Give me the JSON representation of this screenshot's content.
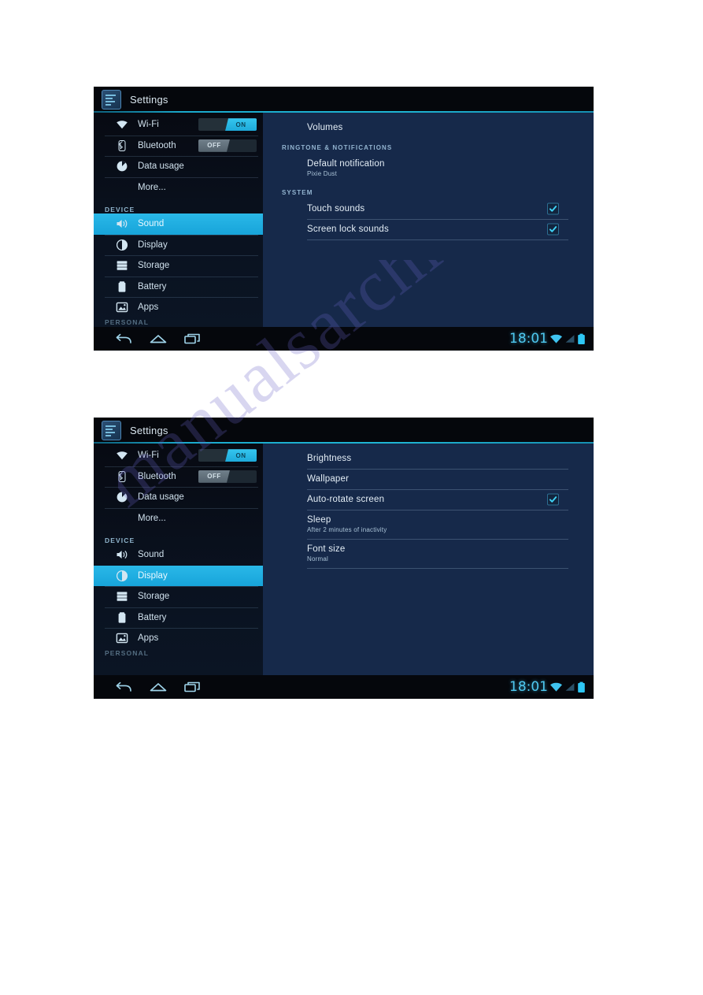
{
  "page": {
    "watermark_text": "manualsarchive.com"
  },
  "screenshots": [
    {
      "id": "sound-settings",
      "action_bar": {
        "icon": "settings-app-icon",
        "title": "Settings"
      },
      "sidebar": {
        "rows": [
          {
            "type": "item",
            "icon": "wifi-icon",
            "label": "Wi-Fi",
            "toggle": "ON",
            "toggle_state": "on",
            "selected": false
          },
          {
            "type": "item",
            "icon": "bluetooth-icon",
            "label": "Bluetooth",
            "toggle": "OFF",
            "toggle_state": "off",
            "selected": false
          },
          {
            "type": "item",
            "icon": "data-usage-icon",
            "label": "Data usage",
            "selected": false
          },
          {
            "type": "item",
            "icon": null,
            "label": "More...",
            "selected": false
          },
          {
            "type": "header",
            "label": "DEVICE"
          },
          {
            "type": "item",
            "icon": "sound-icon",
            "label": "Sound",
            "selected": true
          },
          {
            "type": "item",
            "icon": "display-icon",
            "label": "Display",
            "selected": false
          },
          {
            "type": "item",
            "icon": "storage-icon",
            "label": "Storage",
            "selected": false
          },
          {
            "type": "item",
            "icon": "battery-icon",
            "label": "Battery",
            "selected": false
          },
          {
            "type": "item",
            "icon": "apps-icon",
            "label": "Apps",
            "selected": false
          },
          {
            "type": "header-clipped",
            "label": "PERSONAL"
          }
        ]
      },
      "content": {
        "items": [
          {
            "type": "item",
            "title": "Volumes"
          },
          {
            "type": "header",
            "title": "RINGTONE & NOTIFICATIONS"
          },
          {
            "type": "item",
            "title": "Default notification",
            "subtitle": "Pixie Dust"
          },
          {
            "type": "header",
            "title": "SYSTEM"
          },
          {
            "type": "item",
            "title": "Touch sounds",
            "checkbox": true,
            "checked": true
          },
          {
            "type": "item",
            "title": "Screen lock sounds",
            "checkbox": true,
            "checked": true
          }
        ]
      },
      "navbar": {
        "buttons": [
          "back-icon",
          "home-icon",
          "recents-icon"
        ],
        "clock": "18:01",
        "status_icons": [
          "wifi-status-icon",
          "signal-status-icon",
          "battery-status-icon"
        ]
      }
    },
    {
      "id": "display-settings",
      "action_bar": {
        "icon": "settings-app-icon",
        "title": "Settings"
      },
      "sidebar": {
        "rows": [
          {
            "type": "item",
            "icon": "wifi-icon",
            "label": "Wi-Fi",
            "toggle": "ON",
            "toggle_state": "on",
            "selected": false
          },
          {
            "type": "item",
            "icon": "bluetooth-icon",
            "label": "Bluetooth",
            "toggle": "OFF",
            "toggle_state": "off",
            "selected": false
          },
          {
            "type": "item",
            "icon": "data-usage-icon",
            "label": "Data usage",
            "selected": false
          },
          {
            "type": "item",
            "icon": null,
            "label": "More...",
            "selected": false
          },
          {
            "type": "header",
            "label": "DEVICE"
          },
          {
            "type": "item",
            "icon": "sound-icon",
            "label": "Sound",
            "selected": false
          },
          {
            "type": "item",
            "icon": "display-icon",
            "label": "Display",
            "selected": true
          },
          {
            "type": "item",
            "icon": "storage-icon",
            "label": "Storage",
            "selected": false
          },
          {
            "type": "item",
            "icon": "battery-icon",
            "label": "Battery",
            "selected": false
          },
          {
            "type": "item",
            "icon": "apps-icon",
            "label": "Apps",
            "selected": false
          },
          {
            "type": "header-clipped",
            "label": "PERSONAL"
          }
        ]
      },
      "content": {
        "items": [
          {
            "type": "item",
            "title": "Brightness"
          },
          {
            "type": "item",
            "title": "Wallpaper"
          },
          {
            "type": "item",
            "title": "Auto-rotate screen",
            "checkbox": true,
            "checked": true
          },
          {
            "type": "item",
            "title": "Sleep",
            "subtitle": "After 2 minutes of inactivity"
          },
          {
            "type": "item",
            "title": "Font size",
            "subtitle": "Normal"
          }
        ]
      },
      "navbar": {
        "buttons": [
          "back-icon",
          "home-icon",
          "recents-icon"
        ],
        "clock": "18:01",
        "status_icons": [
          "wifi-status-icon",
          "signal-status-icon",
          "battery-status-icon"
        ]
      }
    }
  ],
  "colors": {
    "accent_cyan": "#2ab8e8",
    "content_bg": "#162a4c",
    "sidebar_bg": "#0a1220",
    "bar_bg": "#05070c",
    "clock": "#4fc9f0",
    "watermark": "#6a63c8"
  }
}
